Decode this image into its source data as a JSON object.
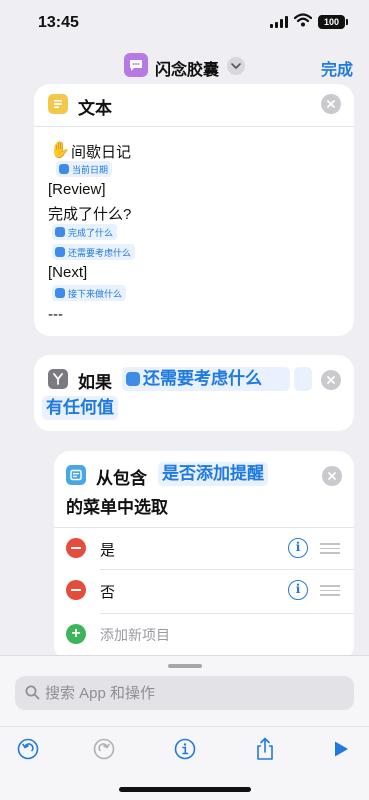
{
  "status_bar": {
    "time": "13:45",
    "battery": "100"
  },
  "nav": {
    "title": "闪念胶囊",
    "done_label": "完成"
  },
  "text_action": {
    "title": "文本",
    "lines": {
      "heading": "间歇日记",
      "date_var": "当前日期",
      "review": "[Review]",
      "question": "完成了什么?",
      "var_done": "完成了什么",
      "var_consider": "还需要考虑什么",
      "next": "[Next]",
      "var_next": "接下来做什么",
      "separator": "---"
    }
  },
  "if_action": {
    "keyword": "如果",
    "variable": "还需要考虑什么",
    "condition": "有任何值"
  },
  "menu_action": {
    "keyword": "从包含",
    "prompt": "是否添加提醒",
    "suffix": "的菜单中选取",
    "items": [
      {
        "label": "是"
      },
      {
        "label": "否"
      }
    ],
    "add_label": "添加新项目"
  },
  "search": {
    "placeholder": "搜索 App 和操作"
  },
  "colors": {
    "accent": "#1f7ae0",
    "remove": "#e54c3c",
    "add": "#3fb55b",
    "text_icon": "#f2c84b",
    "menu_icon": "#4aa7e6",
    "app_icon": "#b57be3"
  }
}
